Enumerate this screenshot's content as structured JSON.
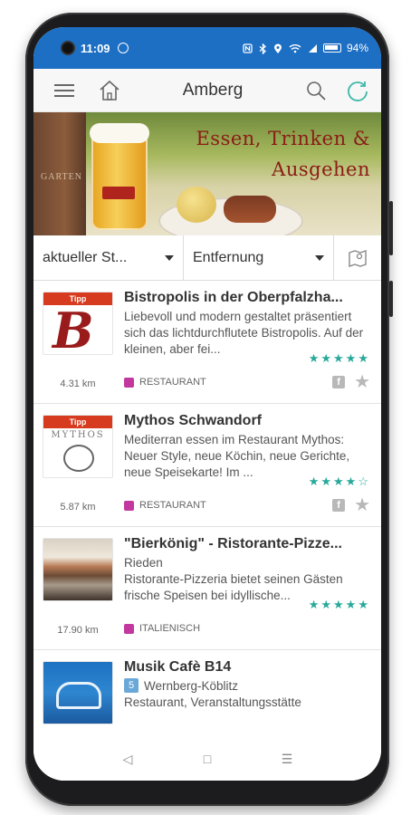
{
  "status": {
    "time": "11:09",
    "battery": "94%",
    "icons": [
      "camera-notch",
      "notification-icon",
      "nfc-icon",
      "bluetooth-icon",
      "location-icon",
      "wifi-icon",
      "signal-icon",
      "battery-icon"
    ]
  },
  "appbar": {
    "title": "Amberg",
    "icons": [
      "menu-icon",
      "home-icon",
      "search-icon",
      "refresh-icon"
    ]
  },
  "banner": {
    "line1": "Essen, Trinken &",
    "line2": "Ausgehen",
    "wood_text": "GARTEN"
  },
  "filters": {
    "sort_label": "aktueller St...",
    "distance_label": "Entfernung",
    "map_icon": "map-icon"
  },
  "items": [
    {
      "title": "Bistropolis in der Oberpfalzha...",
      "description": "Liebevoll und modern gestaltet präsentiert sich das lichtdurchflutete Bistropolis. Auf der kleinen, aber fei...",
      "stars": "★★★★★",
      "distance": "4.31 km",
      "category": "RESTAURANT",
      "tipp": "Tipp",
      "thumb_letter": "B"
    },
    {
      "title": "Mythos Schwandorf",
      "description": "Mediterran essen im Restaurant Mythos: Neuer Style, neue Köchin, neue Gerichte, neue Speisekarte! Im ...",
      "stars": "★★★★☆",
      "distance": "5.87 km",
      "category": "RESTAURANT",
      "tipp": "Tipp",
      "thumb_text": "MYTHOS"
    },
    {
      "title": "\"Bierkönig\" - Ristorante-Pizze...",
      "location": "Rieden",
      "description": "Ristorante-Pizzeria bietet seinen Gästen frische Speisen bei idyllische...",
      "stars": "★★★★★",
      "distance": "17.90 km",
      "category": "ITALIENISCH"
    },
    {
      "title": "Musik Cafè B14",
      "badge": "5",
      "location": "Wernberg-Köblitz",
      "description": "Restaurant, Veranstaltungsstätte"
    }
  ],
  "item_actions": {
    "facebook": "f",
    "favorite": "★"
  },
  "navbar": {
    "back": "◁",
    "home": "□",
    "recents": "☰"
  },
  "colors": {
    "statusbar": "#1d6fc4",
    "stars": "#27a99a",
    "category": "#c2389e",
    "tipp": "#d63b1f",
    "banner_text": "#8b1c16"
  }
}
